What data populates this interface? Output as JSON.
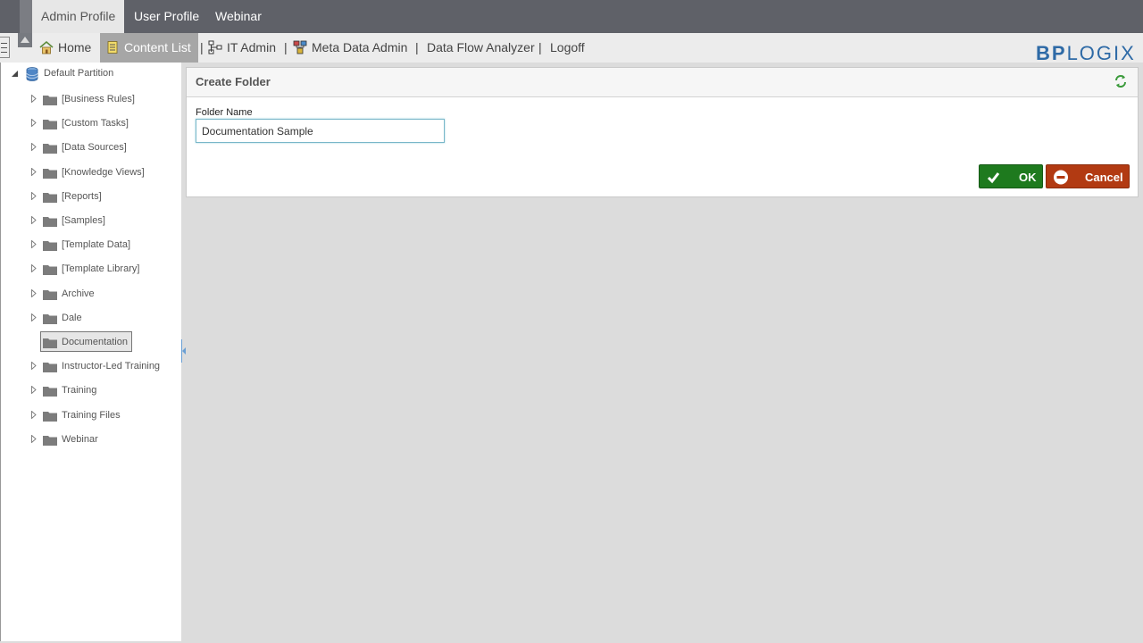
{
  "profile_tabs": [
    {
      "label": "Admin Profile",
      "active": true
    },
    {
      "label": "User Profile",
      "active": false
    },
    {
      "label": "Webinar",
      "active": false
    }
  ],
  "nav": {
    "items": [
      {
        "label": "Home",
        "icon": "home-icon"
      },
      {
        "label": "Content List",
        "icon": "content-list-icon",
        "active": true
      },
      {
        "label": "IT Admin",
        "icon": "it-admin-icon"
      },
      {
        "label": "Meta Data Admin",
        "icon": "meta-data-icon"
      },
      {
        "label": "Data Flow Analyzer"
      },
      {
        "label": "Logoff"
      }
    ],
    "separator": "|"
  },
  "logo": {
    "part1": "BP",
    "part2": "LOGIX"
  },
  "tree": {
    "root": "Default Partition",
    "items": [
      "[Business Rules]",
      "[Custom Tasks]",
      "[Data Sources]",
      "[Knowledge Views]",
      "[Reports]",
      "[Samples]",
      "[Template Data]",
      "[Template Library]",
      "Archive",
      "Dale",
      "Documentation",
      "Instructor-Led Training",
      "Training",
      "Training Files",
      "Webinar"
    ],
    "selected": "Documentation"
  },
  "panel": {
    "title": "Create Folder",
    "field_label": "Folder Name",
    "field_value": "Documentation Sample",
    "ok_label": "OK",
    "cancel_label": "Cancel"
  },
  "colors": {
    "topbar": "#5f6168",
    "ok": "#1e7a1e",
    "cancel": "#b23a12",
    "logo": "#2e6aa6"
  }
}
